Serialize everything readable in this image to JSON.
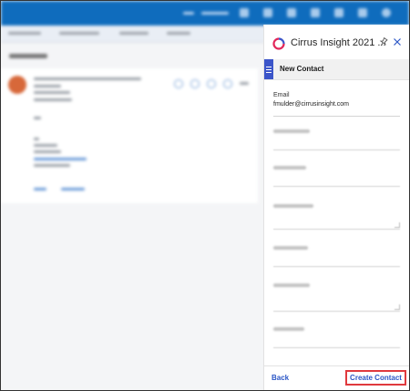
{
  "addin": {
    "title": "Cirrus Insight 2021 ...",
    "section_title": "New Contact",
    "brand_color": "#3b55c9",
    "highlight_color": "#e0393e"
  },
  "form": {
    "email_label": "Email",
    "email_value": "fmulder@cirrusinsight.com"
  },
  "footer": {
    "back_label": "Back",
    "create_label": "Create Contact"
  },
  "icons": [
    "cirrus-logo-icon",
    "pin-icon",
    "close-icon",
    "hamburger-menu-icon"
  ]
}
